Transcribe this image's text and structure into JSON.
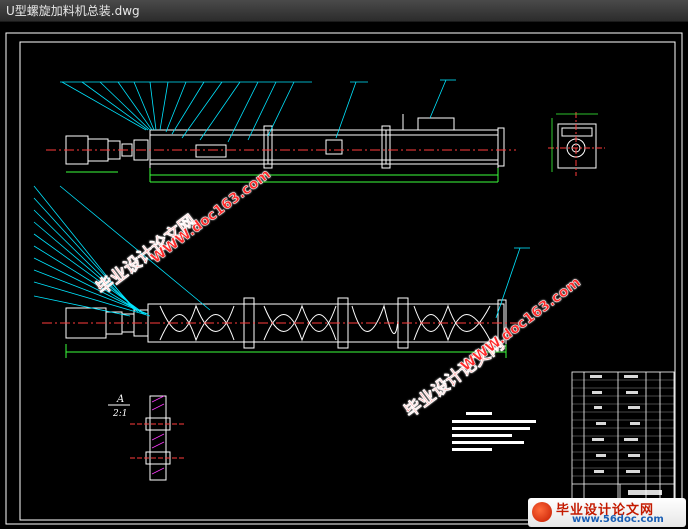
{
  "window": {
    "title": "U型螺旋加料机总装.dwg"
  },
  "drawing": {
    "section_label": "A",
    "section_scale": "2:1"
  },
  "watermarks": {
    "cn_text": "毕业设计论文网",
    "url_text": "WWW.doc163.com"
  },
  "badge": {
    "name": "毕业设计论文网",
    "url": "www.56doc.com"
  },
  "colors": {
    "background": "#000000",
    "frame": "#ffffff",
    "outline": "#ffffff",
    "leader": "#00e5ff",
    "centerline": "#ff3b3b",
    "dimension": "#3bff3b",
    "hatch": "#ff3bff",
    "watermark": "#ff2a2a"
  }
}
